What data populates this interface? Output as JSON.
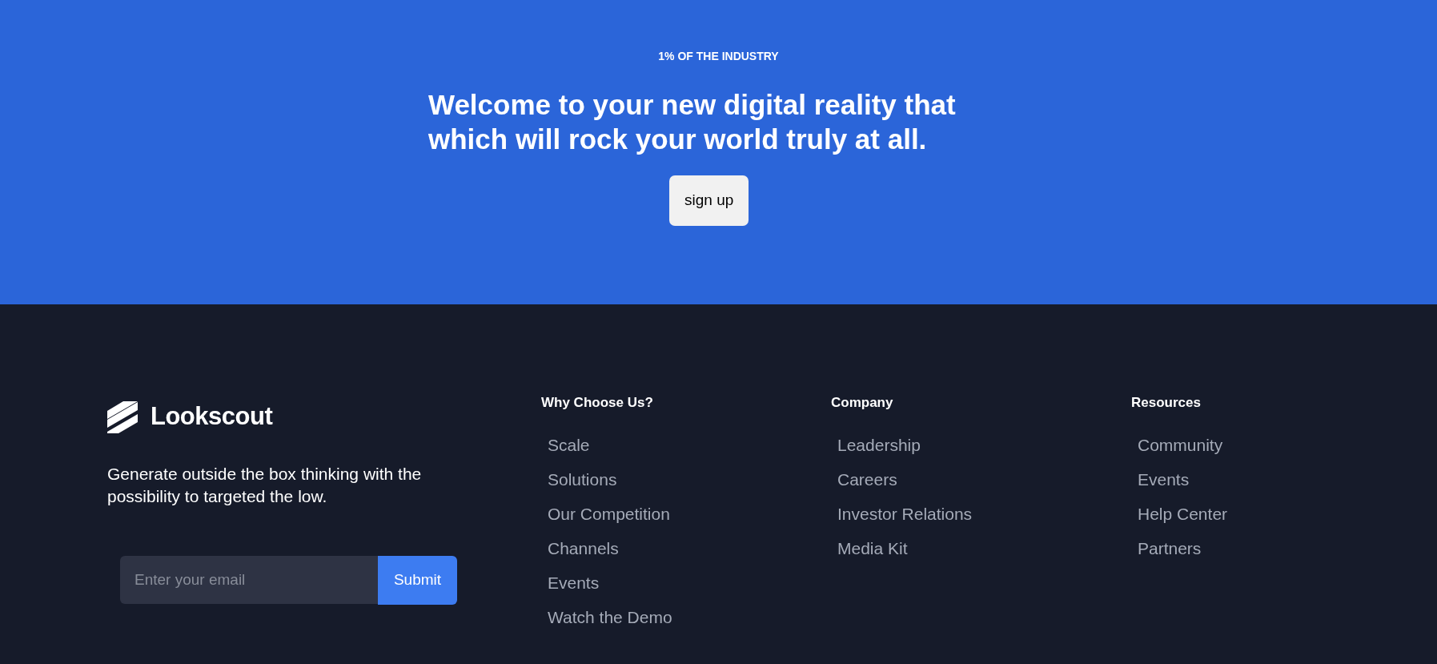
{
  "hero": {
    "eyebrow": "1% OF THE INDUSTRY",
    "headline_lines": [
      "Welcome to your new digital reality that",
      "which will rock your world truly at all."
    ],
    "button": "sign up"
  },
  "footer": {
    "brand": "Lookscout",
    "tagline": "Generate outside the box thinking with the possibility to targeted the low.",
    "newsletter": {
      "placeholder": "Enter your email",
      "button": "Submit"
    },
    "columns": [
      {
        "heading": "Why Choose Us?",
        "links": [
          "Scale",
          "Solutions",
          "Our Competition",
          "Channels",
          "Events",
          "Watch the Demo"
        ]
      },
      {
        "heading": "Company",
        "links": [
          "Leadership",
          "Careers",
          "Investor Relations",
          "Media Kit"
        ]
      },
      {
        "heading": "Resources",
        "links": [
          "Community",
          "Events",
          "Help Center",
          "Partners"
        ]
      }
    ]
  }
}
